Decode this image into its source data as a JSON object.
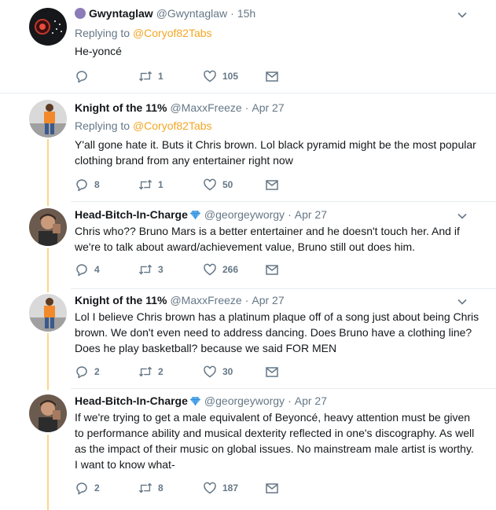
{
  "tweets": [
    {
      "name": "Gwyntaglaw",
      "handle": "@Gwyntaglaw",
      "time": "15h",
      "replying_prefix": "Replying to",
      "replying_to": "@Coryof82Tabs",
      "text": "He-yoncé",
      "reply_count": "",
      "retweet_count": "1",
      "like_count": "105"
    },
    {
      "name": "Knight of the 11%",
      "handle": "@MaxxFreeze",
      "time": "Apr 27",
      "replying_prefix": "Replying to",
      "replying_to": "@Coryof82Tabs",
      "text": "Y'all gone hate it. Buts it Chris brown. Lol black pyramid might be the most popular clothing brand from any entertainer right now",
      "reply_count": "8",
      "retweet_count": "1",
      "like_count": "50"
    },
    {
      "name": "Head-Bitch-In-Charge",
      "handle": "@georgeyworgy",
      "time": "Apr 27",
      "text": "Chris who?? Bruno Mars is a better entertainer and he doesn't touch her. And if we're to talk about award/achievement value, Bruno still out does him.",
      "reply_count": "4",
      "retweet_count": "3",
      "like_count": "266"
    },
    {
      "name": "Knight of the 11%",
      "handle": "@MaxxFreeze",
      "time": "Apr 27",
      "text": "Lol I believe Chris brown has a platinum plaque off of a song just about being Chris brown. We don't even need to address dancing. Does Bruno have a clothing line? Does he play basketball? because we said FOR MEN",
      "reply_count": "2",
      "retweet_count": "2",
      "like_count": "30"
    },
    {
      "name": "Head-Bitch-In-Charge",
      "handle": "@georgeyworgy",
      "time": "Apr 27",
      "text": "If we're trying to get a male equivalent of Beyoncé, heavy attention must be given to performance ability and musical dexterity reflected in one's discography. As well as the impact of their music on global issues. No mainstream male artist is worthy. I want to know what-",
      "reply_count": "2",
      "retweet_count": "8",
      "like_count": "187"
    }
  ],
  "colors": {
    "accent": "#f5a623",
    "thread_line": "#fcd581",
    "muted": "#657786",
    "divider": "#e6ecf0"
  }
}
